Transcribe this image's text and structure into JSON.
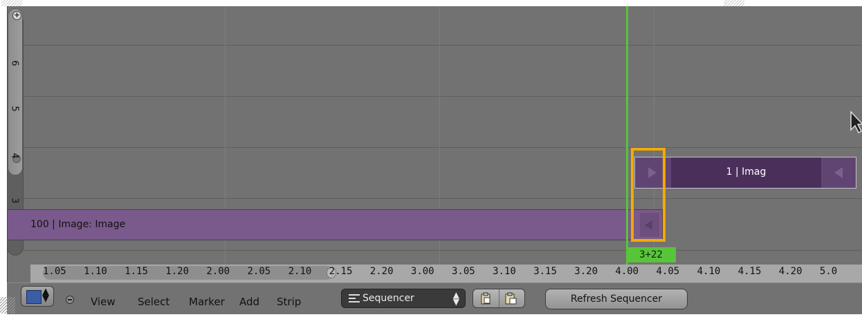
{
  "editor": {
    "name": "Video Sequence Editor",
    "channel_labels": [
      "6",
      "5",
      "4",
      "3"
    ],
    "zoom_handle_glyph": "+"
  },
  "strips": {
    "long": {
      "label": "100 | Image: Image",
      "color": "#7a5a8c"
    },
    "short": {
      "label": "1 | Imag",
      "color": "#4a2f5b"
    }
  },
  "playhead": {
    "frame_label": "3+22",
    "color": "#58c43a"
  },
  "highlight_color": "#f2aa00",
  "ruler": {
    "ticks": [
      "1.05",
      "1.10",
      "1.15",
      "1.20",
      "2.00",
      "2.05",
      "2.10",
      "2.15",
      "2.20",
      "3.00",
      "3.05",
      "3.10",
      "3.15",
      "3.20",
      "4.00",
      "4.05",
      "4.10",
      "4.15",
      "4.20",
      "5.0"
    ]
  },
  "header": {
    "editor_type_icon": "sequencer-editor-icon",
    "menus": [
      "View",
      "Select",
      "Marker",
      "Add",
      "Strip"
    ],
    "view_type": {
      "value": "Sequencer",
      "icon": "sequencer-lines-icon"
    },
    "copy_icon": "copy-clipboard-icon",
    "paste_icon": "paste-clipboard-icon",
    "refresh_label": "Refresh Sequencer"
  }
}
